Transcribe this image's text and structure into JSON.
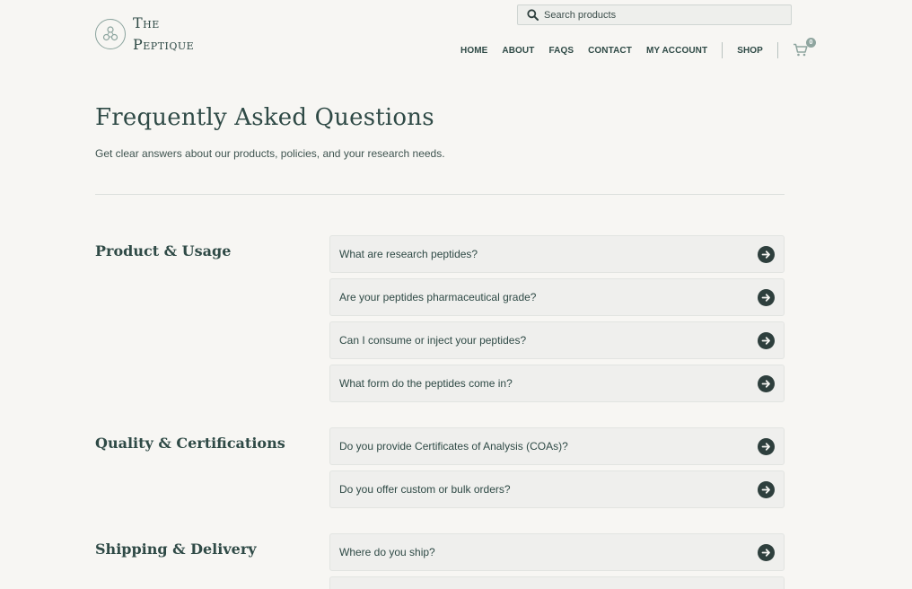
{
  "brand": {
    "line1": "The",
    "line2": "Peptique"
  },
  "search": {
    "placeholder": "Search products",
    "value": ""
  },
  "nav": {
    "items": [
      "HOME",
      "ABOUT",
      "FAQS",
      "CONTACT",
      "MY ACCOUNT"
    ],
    "shop": "SHOP",
    "cart_count": "0"
  },
  "intro": {
    "title": "Frequently Asked Questions",
    "subtitle": "Get clear answers about our products, policies, and your research needs."
  },
  "sections": [
    {
      "title": "Product & Usage",
      "questions": [
        "What are research peptides?",
        "Are your peptides pharmaceutical grade?",
        "Can I consume or inject your peptides?",
        "What form do the peptides come in?"
      ]
    },
    {
      "title": "Quality & Certifications",
      "questions": [
        "Do you provide Certificates of Analysis (COAs)?",
        "Do you offer custom or bulk orders?"
      ]
    },
    {
      "title": "Shipping & Delivery",
      "questions": [
        "Where do you ship?",
        ""
      ]
    }
  ],
  "colors": {
    "background": "#f7f6f3",
    "text": "#2f4a46",
    "accent": "#8fa59f",
    "arrow": "#2e3f3d"
  },
  "icons": {
    "logo": "molecule-icon",
    "search": "search-icon",
    "cart": "cart-icon",
    "arrow": "arrow-right-circle-icon"
  }
}
